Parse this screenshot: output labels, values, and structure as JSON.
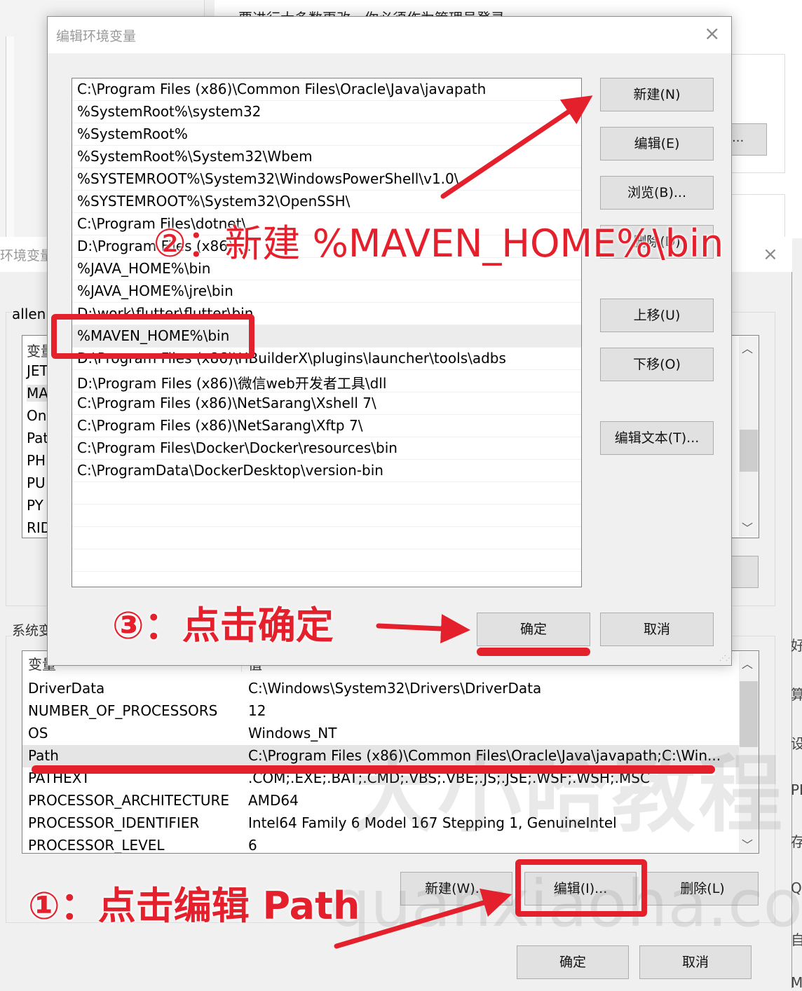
{
  "background_window": {
    "top_text": "要进行大多数更改，你必须作为管理员登录。",
    "ghost_button_label": "...",
    "right_edge_fragments": [
      "好",
      "算",
      "设",
      "PL",
      "存",
      "Qu",
      "自",
      "M"
    ]
  },
  "env_window": {
    "title": "环境变量",
    "close_icon": "×",
    "user_section_label": "allen 的用户变量(U)",
    "user_list": {
      "header": "变量",
      "rows": [
        "JET",
        "MA",
        "On",
        "Pat",
        "PH",
        "PU",
        "PY",
        "RID"
      ]
    },
    "system_section_label": "系统变量(S)",
    "system_list": {
      "headers": {
        "name": "变量",
        "value": "值"
      },
      "rows": [
        {
          "name": "DriverData",
          "value": "C:\\Windows\\System32\\Drivers\\DriverData"
        },
        {
          "name": "NUMBER_OF_PROCESSORS",
          "value": "12"
        },
        {
          "name": "OS",
          "value": "Windows_NT"
        },
        {
          "name": "Path",
          "value": "C:\\Program Files (x86)\\Common Files\\Oracle\\Java\\javapath;C:\\Win...",
          "selected": true
        },
        {
          "name": "PATHEXT",
          "value": ".COM;.EXE;.BAT;.CMD;.VBS;.VBE;.JS;.JSE;.WSF;.WSH;.MSC"
        },
        {
          "name": "PROCESSOR_ARCHITECTURE",
          "value": "AMD64"
        },
        {
          "name": "PROCESSOR_IDENTIFIER",
          "value": "Intel64 Family 6 Model 167 Stepping 1, GenuineIntel"
        },
        {
          "name": "PROCESSOR_LEVEL",
          "value": "6"
        }
      ]
    },
    "buttons": {
      "new": "新建(W)...",
      "edit": "编辑(I)...",
      "delete": "删除(L)",
      "ok": "确定",
      "cancel": "取消"
    }
  },
  "edit_dialog": {
    "title": "编辑环境变量",
    "close_icon": "×",
    "path_entries": [
      "C:\\Program Files (x86)\\Common Files\\Oracle\\Java\\javapath",
      "%SystemRoot%\\system32",
      "%SystemRoot%",
      "%SystemRoot%\\System32\\Wbem",
      "%SYSTEMROOT%\\System32\\WindowsPowerShell\\v1.0\\",
      "%SYSTEMROOT%\\System32\\OpenSSH\\",
      "C:\\Program Files\\dotnet\\",
      "D:\\Program Files (x86)\\...",
      "%JAVA_HOME%\\bin",
      "%JAVA_HOME%\\jre\\bin",
      "D:\\work\\flutter\\flutter\\bin",
      "%MAVEN_HOME%\\bin",
      "D:\\Program Files (x86)\\HBuilderX\\plugins\\launcher\\tools\\adbs",
      "D:\\Program Files (x86)\\微信web开发者工具\\dll",
      "C:\\Program Files (x86)\\NetSarang\\Xshell 7\\",
      "C:\\Program Files (x86)\\NetSarang\\Xftp 7\\",
      "C:\\Program Files\\Docker\\Docker\\resources\\bin",
      "C:\\ProgramData\\DockerDesktop\\version-bin",
      "",
      "",
      "",
      ""
    ],
    "selected_index": 11,
    "buttons": {
      "new": "新建(N)",
      "edit": "编辑(E)",
      "browse": "浏览(B)...",
      "delete": "删除(D)",
      "move_up": "上移(U)",
      "move_down": "下移(O)",
      "edit_text": "编辑文本(T)...",
      "ok": "确定",
      "cancel": "取消"
    }
  },
  "annotations": {
    "step1": "①：点击编辑 Path",
    "step2": "②：新建 %MAVEN_HOME%\\bin",
    "step3": "③：点击确定",
    "color": "#e3202c"
  },
  "watermark": {
    "cn": "大小哈教程",
    "en": "quanxiaoha.com"
  }
}
